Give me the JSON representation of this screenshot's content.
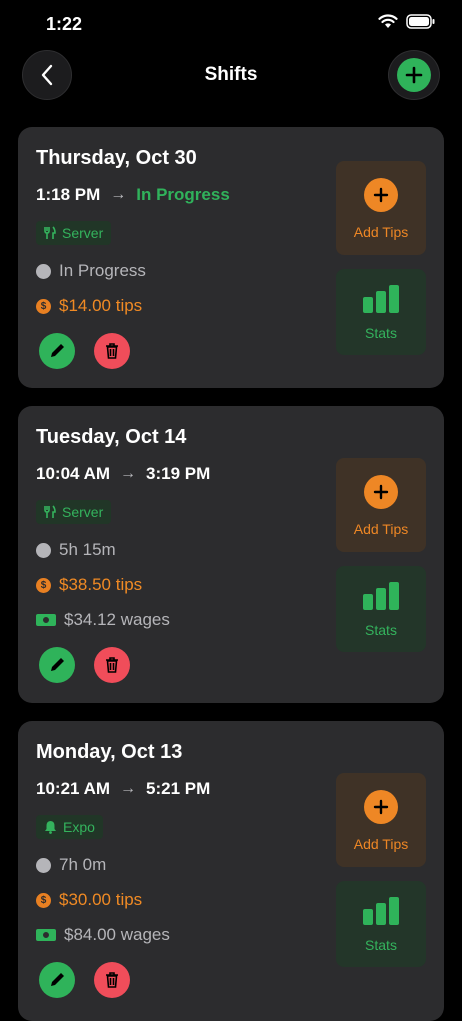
{
  "status_bar": {
    "time": "1:22"
  },
  "nav": {
    "title": "Shifts"
  },
  "shifts": [
    {
      "date": "Thursday, Oct 30",
      "start": "1:18 PM",
      "end": "In Progress",
      "role": "Server",
      "role_icon": "fork-knife-icon",
      "duration": "In Progress",
      "tips": "$14.00 tips",
      "add_tips_label": "Add Tips",
      "stats_label": "Stats"
    },
    {
      "date": "Tuesday, Oct 14",
      "start": "10:04 AM",
      "end": "3:19 PM",
      "role": "Server",
      "role_icon": "fork-knife-icon",
      "duration": "5h 15m",
      "tips": "$38.50 tips",
      "wages": "$34.12 wages",
      "add_tips_label": "Add Tips",
      "stats_label": "Stats"
    },
    {
      "date": "Monday, Oct 13",
      "start": "10:21 AM",
      "end": "5:21 PM",
      "role": "Expo",
      "role_icon": "bell-icon",
      "duration": "7h 0m",
      "tips": "$30.00 tips",
      "wages": "$84.00 wages",
      "add_tips_label": "Add Tips",
      "stats_label": "Stats"
    }
  ],
  "colors": {
    "green": "#30b25b",
    "orange": "#f08a24",
    "red": "#f04d5a",
    "card": "#2c2c2e"
  }
}
